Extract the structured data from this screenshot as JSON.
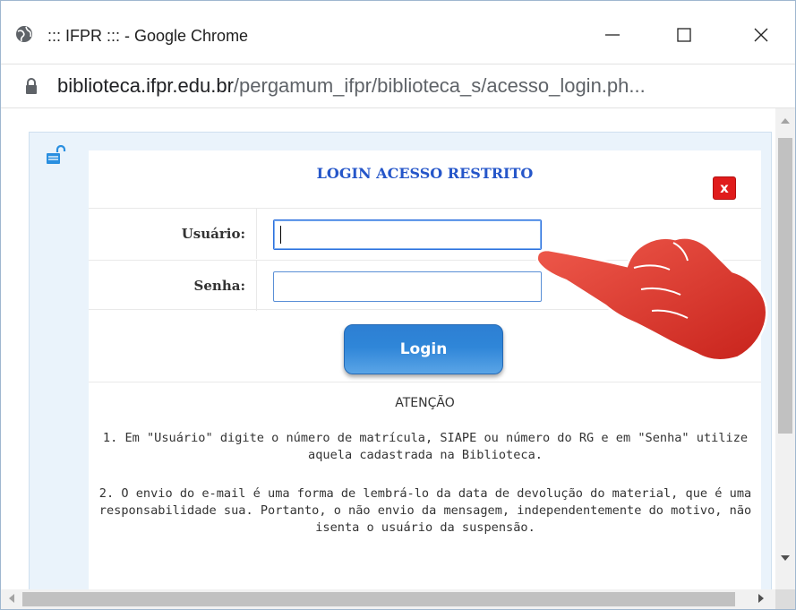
{
  "window": {
    "title": "::: IFPR ::: - Google Chrome",
    "url_host": "biblioteca.ifpr.edu.br",
    "url_path": "/pergamum_ifpr/biblioteca_s/acesso_login.ph..."
  },
  "login": {
    "title": "LOGIN ACESSO RESTRITO",
    "close_label": "x",
    "user_label": "Usuário:",
    "user_value": "",
    "password_label": "Senha:",
    "password_value": "",
    "button_label": "Login"
  },
  "notice": {
    "heading": "ATENÇÃO",
    "item1": "1. Em \"Usuário\" digite o número de matrícula, SIAPE ou número do RG e em \"Senha\" utilize aquela cadastrada na Biblioteca.",
    "item2": "2. O envio do e-mail é uma forma de lembrá-lo da data de devolução do material, que é uma responsabilidade sua. Portanto, o não envio da mensagem, independentemente do motivo, não isenta o usuário da suspensão."
  },
  "colors": {
    "title_blue": "#2556c9",
    "close_red": "#e01b1b",
    "button_blue": "#2f86d8",
    "hand_red": "#e53a32"
  }
}
